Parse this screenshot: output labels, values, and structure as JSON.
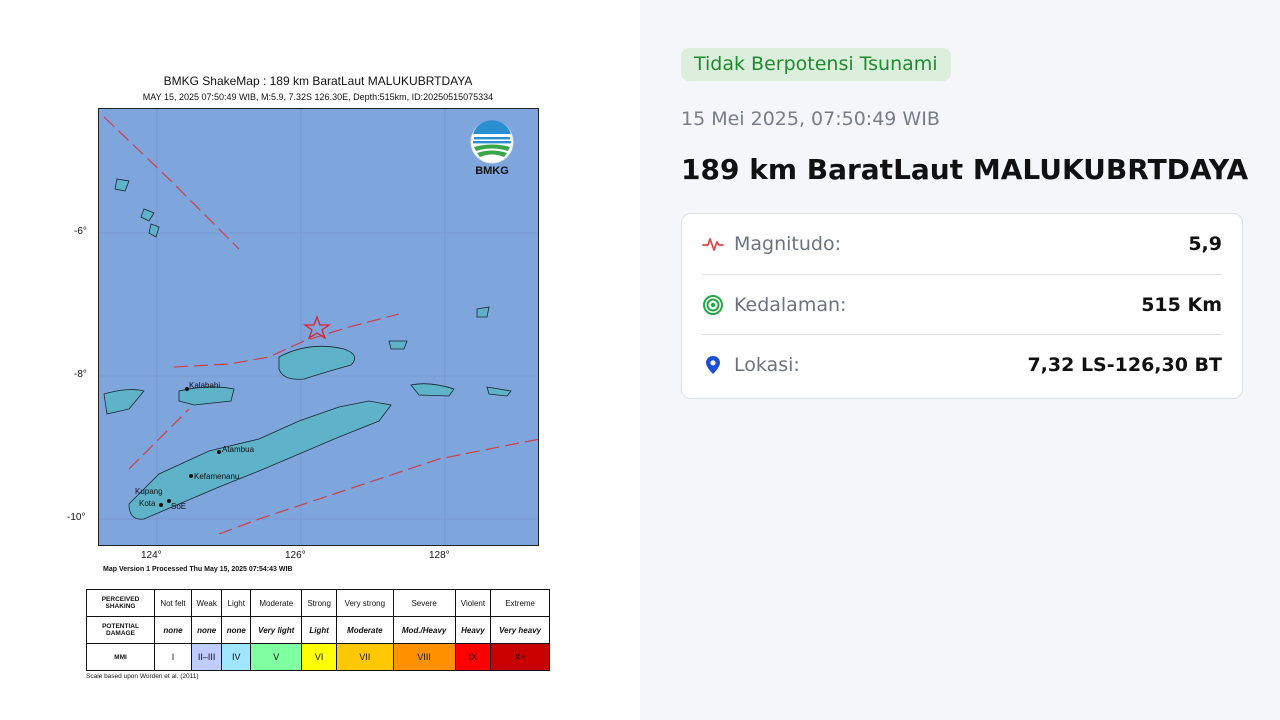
{
  "map": {
    "title": "BMKG ShakeMap : 189 km BaratLaut MALUKUBRTDAYA",
    "subtitle": "MAY 15, 2025 07:50:49 WIB, M:5.9, 7.32S 126.30E, Depth:515km, ID:20250515075334",
    "y_ticks": [
      "-6°",
      "-8°",
      "-10°"
    ],
    "x_ticks": [
      "124°",
      "126°",
      "128°"
    ],
    "logo_text": "BMKG",
    "version_text": "Map Version 1 Processed Thu May 15, 2025 07:54:43 WIB",
    "place_labels": [
      "Kalabahi",
      "Atambua",
      "Kefamenanu",
      "Kupang",
      "SoE",
      "Kota"
    ],
    "ocean_color": "#7ea6dc",
    "land_color": "#5fb3c9",
    "epicenter_color": "#e0202c"
  },
  "scale": {
    "row_headers": [
      "PERCEIVED SHAKING",
      "POTENTIAL DAMAGE",
      "MMI"
    ],
    "shaking": [
      "Not felt",
      "Weak",
      "Light",
      "Moderate",
      "Strong",
      "Very strong",
      "Severe",
      "Violent",
      "Extreme"
    ],
    "damage": [
      "none",
      "none",
      "none",
      "Very light",
      "Light",
      "Moderate",
      "Mod./Heavy",
      "Heavy",
      "Very heavy"
    ],
    "mmi": [
      "I",
      "II–III",
      "IV",
      "V",
      "VI",
      "VII",
      "VIII",
      "IX",
      "X+"
    ],
    "mmi_colors": [
      "#ffffff",
      "#bfccff",
      "#a0e6ff",
      "#80ffa0",
      "#ffff00",
      "#ffc800",
      "#ff9100",
      "#ff0000",
      "#c80000"
    ],
    "note": "Scale based upon Worden et al. (2011)"
  },
  "info": {
    "badge": "Tidak Berpotensi Tsunami",
    "datetime": "15 Mei 2025, 07:50:49 WIB",
    "location": "189 km BaratLaut MALUKUBRTDAYA",
    "rows": [
      {
        "label": "Magnitudo:",
        "value": "5,9",
        "icon": "pulse-icon"
      },
      {
        "label": "Kedalaman:",
        "value": "515 Km",
        "icon": "target-icon"
      },
      {
        "label": "Lokasi:",
        "value": "7,32 LS-126,30 BT",
        "icon": "map-pin-icon"
      }
    ],
    "colors": {
      "badge_bg": "#dcefdc",
      "badge_text": "#1f8a2e",
      "pulse": "#e04848",
      "target": "#22a846",
      "pin": "#1d4ed8"
    }
  }
}
